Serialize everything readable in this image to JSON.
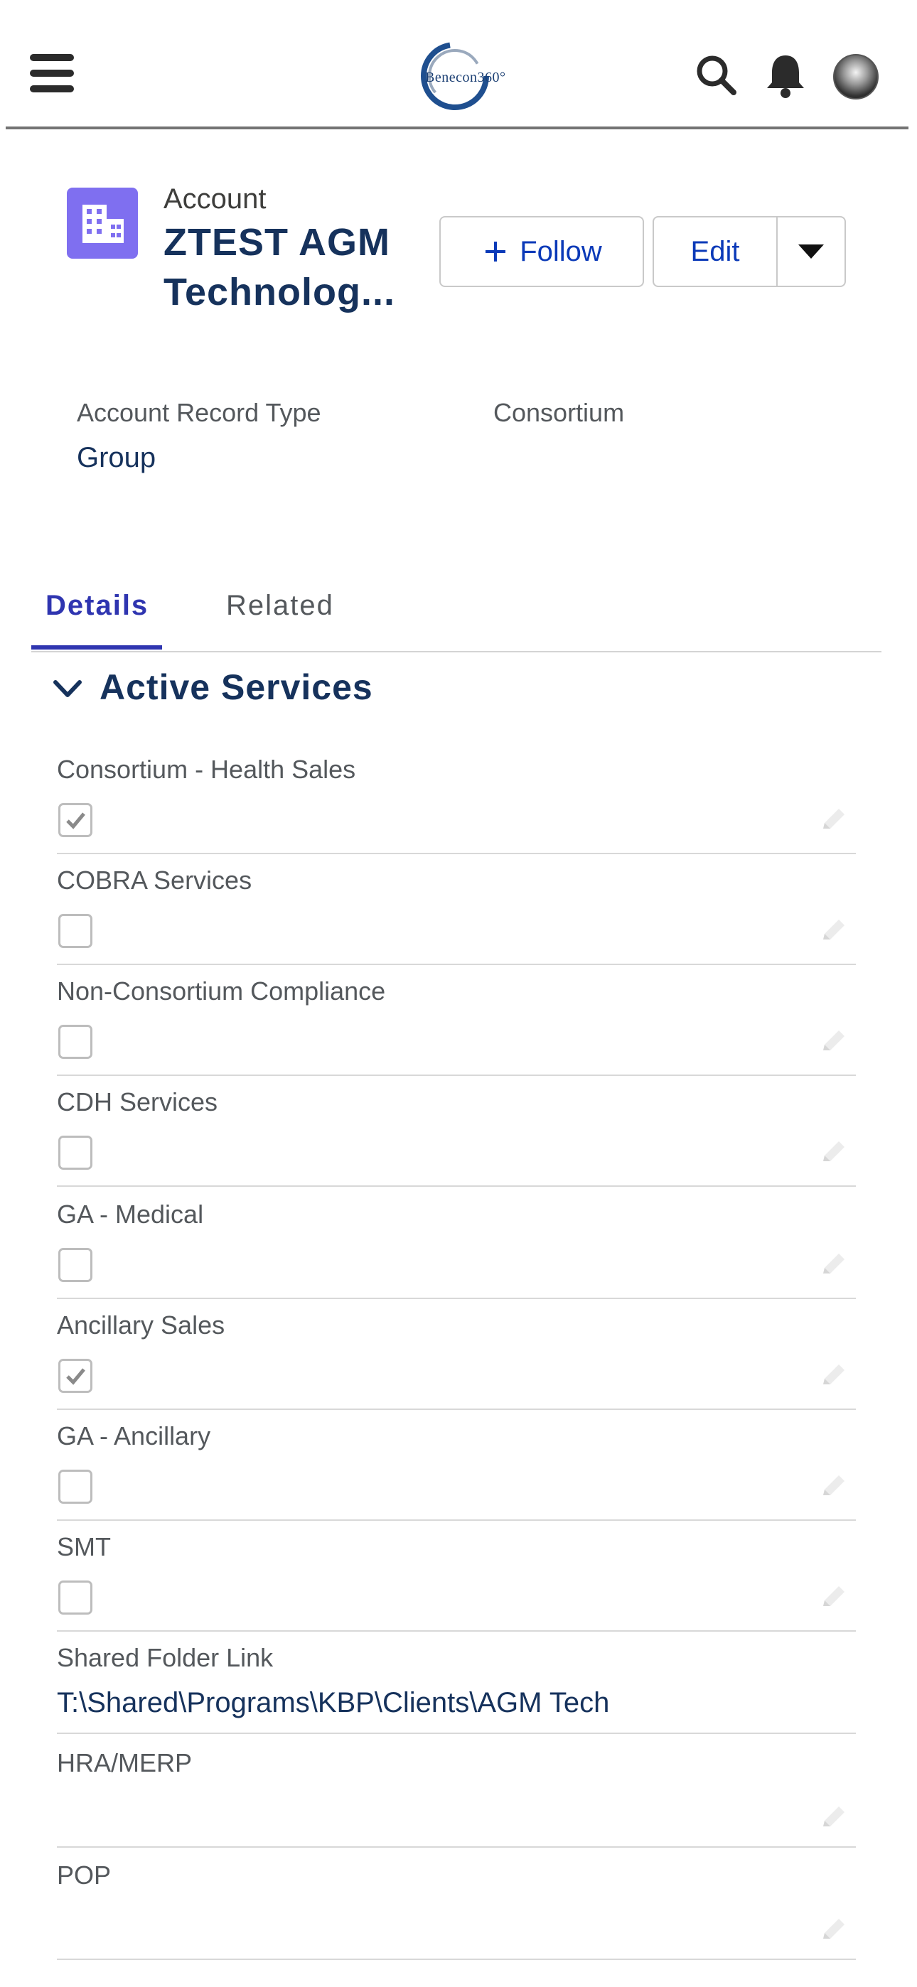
{
  "app": {
    "logo_text": "Benecon360°"
  },
  "topbar": {
    "menu_icon": "hamburger-menu-icon",
    "search_icon": "search-icon",
    "notifications_icon": "bell-icon",
    "avatar": "user-avatar"
  },
  "record": {
    "object_label": "Account",
    "name_line1": "ZTEST AGM",
    "name_line2": "Technolog...",
    "follow_label": "Follow",
    "edit_label": "Edit"
  },
  "highlights": [
    {
      "label": "Account Record Type",
      "value": "Group"
    },
    {
      "label": "Consortium",
      "value": ""
    }
  ],
  "tabs": [
    {
      "label": "Details",
      "active": true
    },
    {
      "label": "Related",
      "active": false
    }
  ],
  "section": {
    "title": "Active Services"
  },
  "fields": [
    {
      "label": "Consortium - Health Sales",
      "type": "checkbox",
      "checked": true
    },
    {
      "label": "COBRA Services",
      "type": "checkbox",
      "checked": false
    },
    {
      "label": "Non-Consortium Compliance",
      "type": "checkbox",
      "checked": false
    },
    {
      "label": "CDH Services",
      "type": "checkbox",
      "checked": false
    },
    {
      "label": "GA - Medical",
      "type": "checkbox",
      "checked": false
    },
    {
      "label": "Ancillary Sales",
      "type": "checkbox",
      "checked": true
    },
    {
      "label": "GA - Ancillary",
      "type": "checkbox",
      "checked": false
    },
    {
      "label": "SMT",
      "type": "checkbox",
      "checked": false
    },
    {
      "label": "Shared Folder Link",
      "type": "text",
      "value": "T:\\Shared\\Programs\\KBP\\Clients\\AGM Tech"
    },
    {
      "label": "HRA/MERP",
      "type": "text",
      "value": ""
    },
    {
      "label": "POP",
      "type": "text",
      "value": ""
    }
  ],
  "colors": {
    "brand_blue": "#2f35b0",
    "account_icon": "#7f6ff0",
    "record_title": "#16325c"
  }
}
